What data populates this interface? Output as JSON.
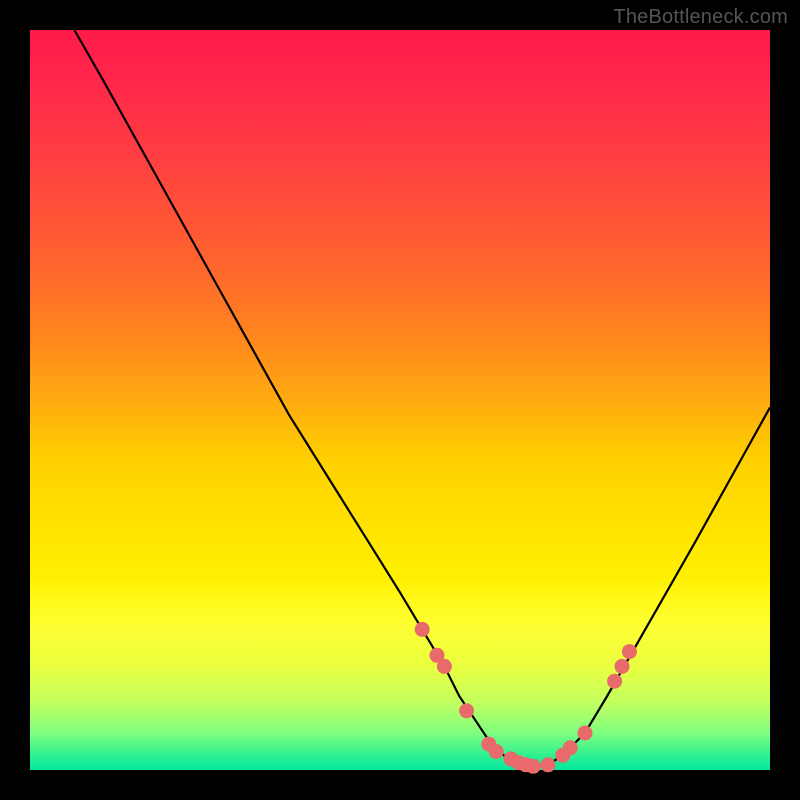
{
  "watermark": "TheBottleneck.com",
  "chart_data": {
    "type": "line",
    "title": "",
    "xlabel": "",
    "ylabel": "",
    "xlim": [
      0,
      100
    ],
    "ylim": [
      0,
      100
    ],
    "grid": false,
    "legend": false,
    "series": [
      {
        "name": "bottleneck-curve",
        "x": [
          6,
          10,
          15,
          20,
          25,
          30,
          35,
          40,
          45,
          50,
          53,
          56,
          58,
          60,
          62,
          64,
          66,
          68,
          70,
          72,
          75,
          78,
          82,
          86,
          90,
          95,
          100
        ],
        "values": [
          100,
          93,
          84,
          75,
          66,
          57,
          48,
          40,
          32,
          24,
          19,
          14,
          10,
          7,
          4,
          2,
          1,
          0.5,
          0.7,
          2,
          5,
          10,
          17,
          24,
          31,
          40,
          49
        ]
      }
    ],
    "markers": [
      {
        "x": 53,
        "y": 19
      },
      {
        "x": 55,
        "y": 15.5
      },
      {
        "x": 56,
        "y": 14
      },
      {
        "x": 59,
        "y": 8
      },
      {
        "x": 62,
        "y": 3.5
      },
      {
        "x": 63,
        "y": 2.5
      },
      {
        "x": 65,
        "y": 1.5
      },
      {
        "x": 66,
        "y": 1
      },
      {
        "x": 67,
        "y": 0.7
      },
      {
        "x": 68,
        "y": 0.5
      },
      {
        "x": 70,
        "y": 0.7
      },
      {
        "x": 72,
        "y": 2
      },
      {
        "x": 73,
        "y": 3
      },
      {
        "x": 75,
        "y": 5
      },
      {
        "x": 79,
        "y": 12
      },
      {
        "x": 80,
        "y": 14
      },
      {
        "x": 81,
        "y": 16
      }
    ],
    "background_gradient": {
      "top": "#ff1a4a",
      "mid": "#ffe000",
      "bottom": "#00e8a0"
    }
  }
}
